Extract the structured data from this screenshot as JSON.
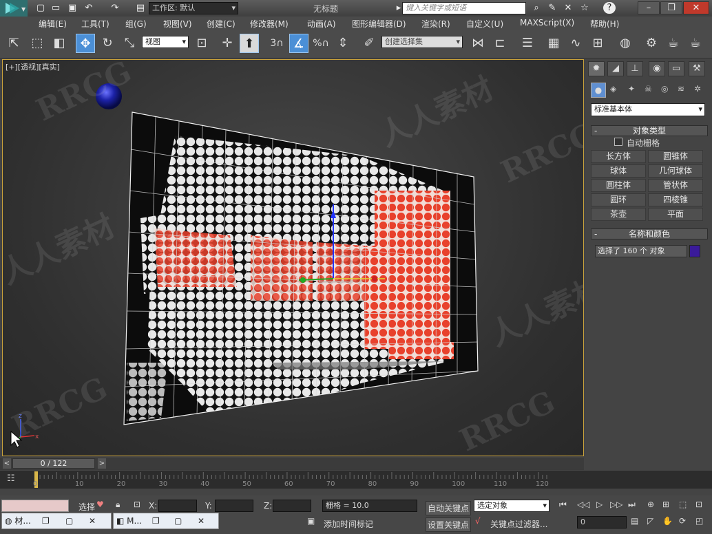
{
  "app": {
    "workspace_label": "工作区: 默认",
    "window_title": "无标题",
    "search_placeholder": "键入关键字或短语"
  },
  "menu": [
    "编辑(E)",
    "工具(T)",
    "组(G)",
    "视图(V)",
    "创建(C)",
    "修改器(M)",
    "动画(A)",
    "图形编辑器(D)",
    "渲染(R)",
    "自定义(U)",
    "MAXScript(X)",
    "帮助(H)"
  ],
  "toolbar": {
    "ref_coord": "视图",
    "selection_set_placeholder": "创建选择集",
    "snap_label": "3"
  },
  "viewport": {
    "label": "[+][透视][真实]",
    "axis_labels": {
      "x": "x",
      "y": "y",
      "z": "z"
    }
  },
  "command_panel": {
    "category_dropdown": "标准基本体",
    "object_type_title": "对象类型",
    "autogrid_label": "自动栅格",
    "buttons": [
      "长方体",
      "圆锥体",
      "球体",
      "几何球体",
      "圆柱体",
      "管状体",
      "圆环",
      "四棱锥",
      "茶壶",
      "平面"
    ],
    "name_color_title": "名称和颜色",
    "name_field_value": "选择了 160 个 对象",
    "swatch_color": "#3a1a9a"
  },
  "timeline": {
    "frame_display": "0 / 122",
    "ticks": [
      "0",
      "10",
      "20",
      "30",
      "40",
      "50",
      "60",
      "70",
      "80",
      "90",
      "100",
      "110",
      "120"
    ]
  },
  "status": {
    "selected_label": "选择",
    "x_label": "X:",
    "y_label": "Y:",
    "z_label": "Z:",
    "grid_label": "栅格 = 10.0",
    "add_time_tag": "添加时间标记",
    "auto_key": "自动关键点",
    "selected_object": "选定对象",
    "set_key": "设置关键点",
    "key_filters": "关键点过滤器...",
    "frame_field": "0"
  },
  "taskbar": {
    "item1": "材...",
    "item2": "M..."
  },
  "watermarks": [
    "RRCG",
    "人人素材"
  ]
}
